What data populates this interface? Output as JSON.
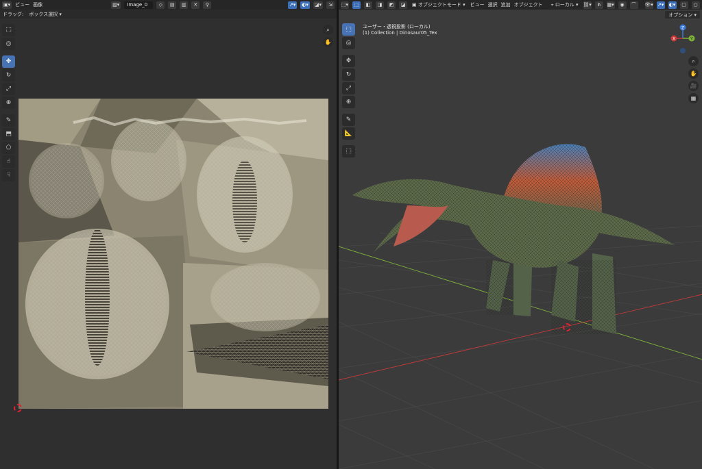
{
  "uv_editor": {
    "menu": {
      "view": "ビュー",
      "image": "画像"
    },
    "image_name": "Image_0",
    "drag_label": "ドラッグ:",
    "drag_mode": "ボックス選択"
  },
  "viewport": {
    "mode": "オブジェクトモード",
    "menu": {
      "view": "ビュー",
      "select": "選択",
      "add": "追加",
      "object": "オブジェクト"
    },
    "transform_orientation": "ローカル",
    "options_label": "オプション",
    "view_name": "ユーザー・透視投影 (ローカル)",
    "collection_line": "(1) Collection | Dinosaur05_Tex",
    "gizmo": {
      "z": "Z",
      "y": "Y",
      "x": "X"
    }
  },
  "colors": {
    "accent": "#4772b3",
    "x_axis": "#c83a3a",
    "y_axis": "#7fb23a",
    "z_axis": "#3d7bd9"
  }
}
